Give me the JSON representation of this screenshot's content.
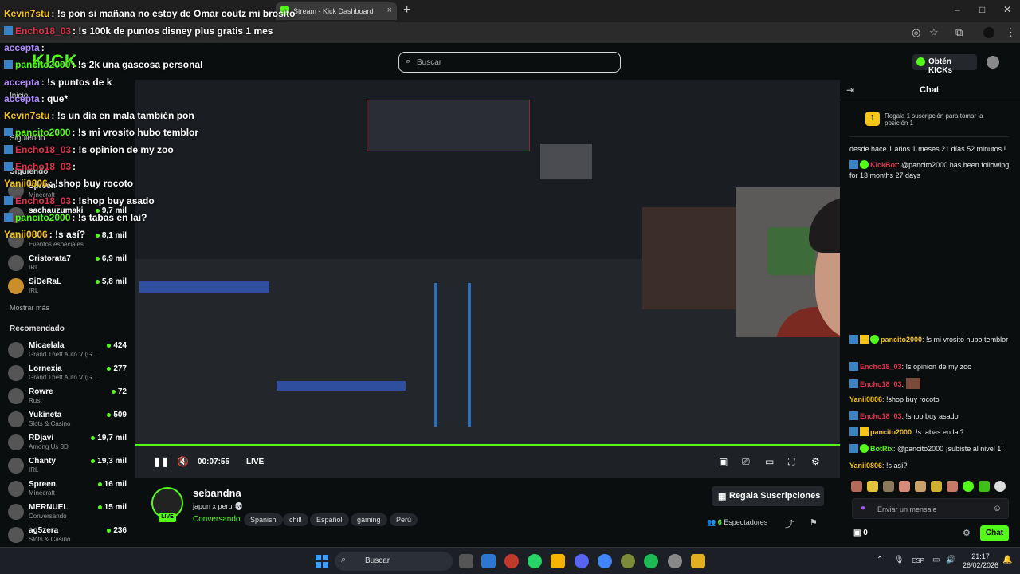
{
  "browser": {
    "tabs": [
      {
        "label": "Stream - Kick Dashboard"
      }
    ],
    "new_tab": "+",
    "window_controls": {
      "minimize": "–",
      "maximize": "□",
      "close": "✕"
    }
  },
  "site": {
    "logo": "KICK",
    "search_placeholder": "Buscar",
    "kicks_button": "Obtén KICKs"
  },
  "sidebar": {
    "nav_home": "Inicio",
    "following_header": "Siguiendo",
    "following_label": "Siguiendo",
    "following": [
      {
        "name": "Spreen",
        "category": "Minecraft",
        "viewers": ""
      },
      {
        "name": "sachauzumaki",
        "category": "",
        "viewers": "9,7 mil"
      },
      {
        "name": "",
        "category": "Eventos especiales",
        "viewers": "8,1 mil"
      },
      {
        "name": "Cristorata7",
        "category": "IRL",
        "viewers": "6,9 mil"
      },
      {
        "name": "SiDeRaL",
        "category": "IRL",
        "viewers": "5,8 mil"
      }
    ],
    "show_more": "Mostrar más",
    "recommended_header": "Recomendado",
    "recommended": [
      {
        "name": "Micaelala",
        "category": "Grand Theft Auto V (G...",
        "viewers": "424"
      },
      {
        "name": "Lornexia",
        "category": "Grand Theft Auto V (G...",
        "viewers": "277"
      },
      {
        "name": "Rowre",
        "category": "Rust",
        "viewers": "72"
      },
      {
        "name": "Yukineta",
        "category": "Slots & Casino",
        "viewers": "509"
      },
      {
        "name": "RDjavi",
        "category": "Among Us 3D",
        "viewers": "19,7 mil"
      },
      {
        "name": "Chanty",
        "category": "IRL",
        "viewers": "19,3 mil"
      },
      {
        "name": "Spreen",
        "category": "Minecraft",
        "viewers": "16 mil"
      },
      {
        "name": "MERNUEL",
        "category": "Conversando",
        "viewers": "15 mil"
      },
      {
        "name": "ag5zera",
        "category": "Slots & Casino",
        "viewers": "236"
      }
    ]
  },
  "overlay_chat": [
    {
      "user": "Kevin7stu",
      "text": ": !s pon si mañana no estoy de Omar coutz mi brosito",
      "color": "#f5c518"
    },
    {
      "user": "Encho18_03",
      "text": ": !s 100k de puntos disney plus gratis 1 mes",
      "color": "#e0324b"
    },
    {
      "user": "accepta",
      "text": ":",
      "color": "#b18cff"
    },
    {
      "user": "pancito2000",
      "text": ": !s 2k una gaseosa personal",
      "color": "#53fc18"
    },
    {
      "user": "accepta",
      "text": ": !s puntos de k",
      "color": "#b18cff"
    },
    {
      "user": "accepta",
      "text": ": que*",
      "color": "#b18cff"
    },
    {
      "user": "Kevin7stu",
      "text": ": !s un día en mala también pon",
      "color": "#f5c518"
    },
    {
      "user": "pancito2000",
      "text": ": !s mi vrosito hubo temblor",
      "color": "#53fc18"
    },
    {
      "user": "Encho18_03",
      "text": ": !s opinion de my zoo",
      "color": "#e0324b"
    },
    {
      "user": "Encho18_03",
      "text": ":",
      "color": "#e0324b"
    },
    {
      "user": "Yanii0806",
      "text": ": !shop buy rocoto",
      "color": "#f5c518"
    },
    {
      "user": "Encho18_03",
      "text": ": !shop buy asado",
      "color": "#e0324b"
    },
    {
      "user": "pancito2000",
      "text": ": !s tabas en lai?",
      "color": "#53fc18"
    },
    {
      "user": "Yanii0806",
      "text": ": !s así?",
      "color": "#f5c518"
    }
  ],
  "player": {
    "time": "00:07:55",
    "live": "LIVE"
  },
  "stream": {
    "channel": "sebandna",
    "title": "japon x peru 💀",
    "category": "Conversando",
    "live_badge": "LIVE",
    "tags": [
      "Spanish",
      "chill",
      "Español",
      "gaming",
      "Perú"
    ],
    "gift_button": "Regala Suscripciones",
    "viewer_count": "6",
    "viewer_label": "Espectadores"
  },
  "chat": {
    "title": "Chat",
    "pinned_text": "Regala 1 suscripción para tomar la posición 1",
    "pinned_rank": "1",
    "messages": [
      {
        "user": "",
        "text": "desde hace 1 años 1 meses 21 días 52 minutos !",
        "color": "#eee"
      },
      {
        "user": "KickBot",
        "text": ": @pancito2000 has been following for 13 months 27 days",
        "color": "#e0324b"
      },
      {
        "user": "pancito2000",
        "text": ": !s mi vrosito hubo temblor",
        "color": "#f5c518"
      },
      {
        "user": "Encho18_03",
        "text": ": !s opinion de my zoo",
        "color": "#e0324b"
      },
      {
        "user": "Encho18_03",
        "text": ":",
        "color": "#e0324b"
      },
      {
        "user": "Yanii0806",
        "text": ": !shop buy rocoto",
        "color": "#f5c518"
      },
      {
        "user": "Encho18_03",
        "text": ": !shop buy asado",
        "color": "#e0324b"
      },
      {
        "user": "pancito2000",
        "text": ": !s tabas en lai?",
        "color": "#f5c518"
      },
      {
        "user": "BotRix",
        "text": ": @pancito2000 ¡subiste al nivel 1!",
        "color": "#53fc18"
      },
      {
        "user": "Yanii0806",
        "text": ": !s así?",
        "color": "#f5c518"
      }
    ],
    "input_placeholder": "Enviar un mensaje",
    "points": "0",
    "chat_button": "Chat"
  },
  "taskbar": {
    "search_placeholder": "Buscar",
    "language": "ESP",
    "time": "21:17",
    "date": "26/02/2026"
  }
}
